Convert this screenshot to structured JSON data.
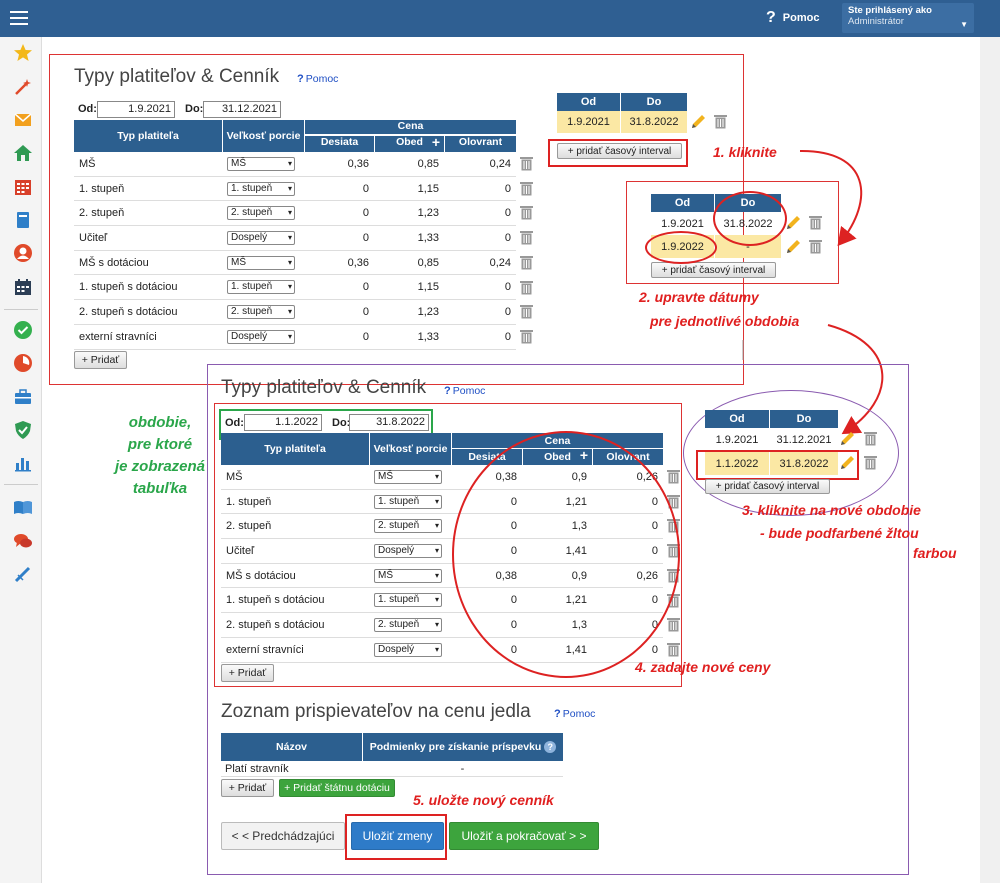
{
  "topbar": {
    "help_label": "Pomoc",
    "help_icon": "question-icon",
    "user_line1": "Ste prihlásený ako",
    "user_line2": "Administrátor"
  },
  "sidebar": {
    "icons": [
      "star-icon",
      "magic-wand-icon",
      "envelope-icon",
      "home-icon",
      "calendar-grid-icon",
      "book-icon",
      "user-circle-icon",
      "calendar-icon",
      "check-circle-icon",
      "chart-pie-icon",
      "briefcase-icon",
      "shield-icon",
      "bar-chart-icon",
      "open-book-icon",
      "chat-icon",
      "pen-icon"
    ]
  },
  "panel1": {
    "title": "Typy platiteľov & Cenník",
    "help": "Pomoc",
    "od_label": "Od:",
    "od_value": "1.9.2021",
    "do_label": "Do:",
    "do_value": "31.12.2021",
    "headers": {
      "type": "Typ platiteľa",
      "portion": "Veľkosť porcie",
      "price": "Cena",
      "desiata": "Desiata",
      "obed": "Obed",
      "olovrant": "Olovrant"
    },
    "rows": [
      {
        "type": "MŠ",
        "portion": "MŠ",
        "desiata": "0,36",
        "obed": "0,85",
        "olovrant": "0,24"
      },
      {
        "type": "1. stupeň",
        "portion": "1. stupeň",
        "desiata": "0",
        "obed": "1,15",
        "olovrant": "0"
      },
      {
        "type": "2. stupeň",
        "portion": "2. stupeň",
        "desiata": "0",
        "obed": "1,23",
        "olovrant": "0"
      },
      {
        "type": "Učiteľ",
        "portion": "Dospelý",
        "desiata": "0",
        "obed": "1,33",
        "olovrant": "0"
      },
      {
        "type": "MŠ s dotáciou",
        "portion": "MŠ",
        "desiata": "0,36",
        "obed": "0,85",
        "olovrant": "0,24"
      },
      {
        "type": "1. stupeň s dotáciou",
        "portion": "1. stupeň",
        "desiata": "0",
        "obed": "1,15",
        "olovrant": "0"
      },
      {
        "type": "2. stupeň s dotáciou",
        "portion": "2. stupeň",
        "desiata": "0",
        "obed": "1,23",
        "olovrant": "0"
      },
      {
        "type": "externí stravníci",
        "portion": "Dospelý",
        "desiata": "0",
        "obed": "1,33",
        "olovrant": "0"
      }
    ],
    "add_button": "+ Pridať"
  },
  "periods1": {
    "od": "Od",
    "do": "Do",
    "rows": [
      {
        "od": "1.9.2021",
        "do": "31.8.2022"
      }
    ],
    "add": "+ pridať časový interval"
  },
  "periods2": {
    "od": "Od",
    "do": "Do",
    "rows": [
      {
        "od": "1.9.2021",
        "do": "31.8.2022"
      },
      {
        "od": "1.9.2022",
        "do": "-"
      }
    ],
    "add": "+ pridať časový interval"
  },
  "periods3": {
    "od": "Od",
    "do": "Do",
    "rows": [
      {
        "od": "1.9.2021",
        "do": "31.12.2021"
      },
      {
        "od": "1.1.2022",
        "do": "31.8.2022"
      }
    ],
    "add": "+ pridať časový interval"
  },
  "panel2": {
    "title": "Typy platiteľov & Cenník",
    "help": "Pomoc",
    "od_label": "Od:",
    "od_value": "1.1.2022",
    "do_label": "Do:",
    "do_value": "31.8.2022",
    "rows": [
      {
        "type": "MŠ",
        "portion": "MŠ",
        "desiata": "0,38",
        "obed": "0,9",
        "olovrant": "0,26"
      },
      {
        "type": "1. stupeň",
        "portion": "1. stupeň",
        "desiata": "0",
        "obed": "1,21",
        "olovrant": "0"
      },
      {
        "type": "2. stupeň",
        "portion": "2. stupeň",
        "desiata": "0",
        "obed": "1,3",
        "olovrant": "0"
      },
      {
        "type": "Učiteľ",
        "portion": "Dospelý",
        "desiata": "0",
        "obed": "1,41",
        "olovrant": "0"
      },
      {
        "type": "MŠ s dotáciou",
        "portion": "MŠ",
        "desiata": "0,38",
        "obed": "0,9",
        "olovrant": "0,26"
      },
      {
        "type": "1. stupeň s dotáciou",
        "portion": "1. stupeň",
        "desiata": "0",
        "obed": "1,21",
        "olovrant": "0"
      },
      {
        "type": "2. stupeň s dotáciou",
        "portion": "2. stupeň",
        "desiata": "0",
        "obed": "1,3",
        "olovrant": "0"
      },
      {
        "type": "externí stravníci",
        "portion": "Dospelý",
        "desiata": "0",
        "obed": "1,41",
        "olovrant": "0"
      }
    ],
    "add_button": "+ Pridať"
  },
  "contrib": {
    "title": "Zoznam prispievateľov na cenu jedla",
    "help": "Pomoc",
    "col_name": "Názov",
    "col_cond": "Podmienky pre získanie príspevku",
    "row_name": "Platí stravník",
    "row_cond": "-",
    "add": "+ Pridať",
    "add_state": "+ Pridať štátnu dotáciu"
  },
  "footer": {
    "prev": "< < Predchádzajúci",
    "save": "Uložiť zmeny",
    "save_continue": "Uložiť a pokračovať > >"
  },
  "annotations": {
    "a1": "1.  kliknite",
    "a2_l1": "2. upravte dátumy",
    "a2_l2": "pre jednotlivé obdobia",
    "a3_l1": "3. kliknite na nové obdobie",
    "a3_l2": "- bude podfarbené žltou",
    "a3_l3": "farbou",
    "a4": "4. zadajte nové ceny",
    "a5": "5.  uložte nový cenník",
    "green_l1": "obdobie,",
    "green_l2": "pre ktoré",
    "green_l3": "je zobrazená",
    "green_l4": "tabuľka"
  },
  "colors": {
    "header_blue": "#2c5f8f",
    "topbar": "#2f5f92",
    "annotation_red": "#e02020",
    "annotation_green": "#2aa64a",
    "selected_row": "#fbe8a4"
  }
}
